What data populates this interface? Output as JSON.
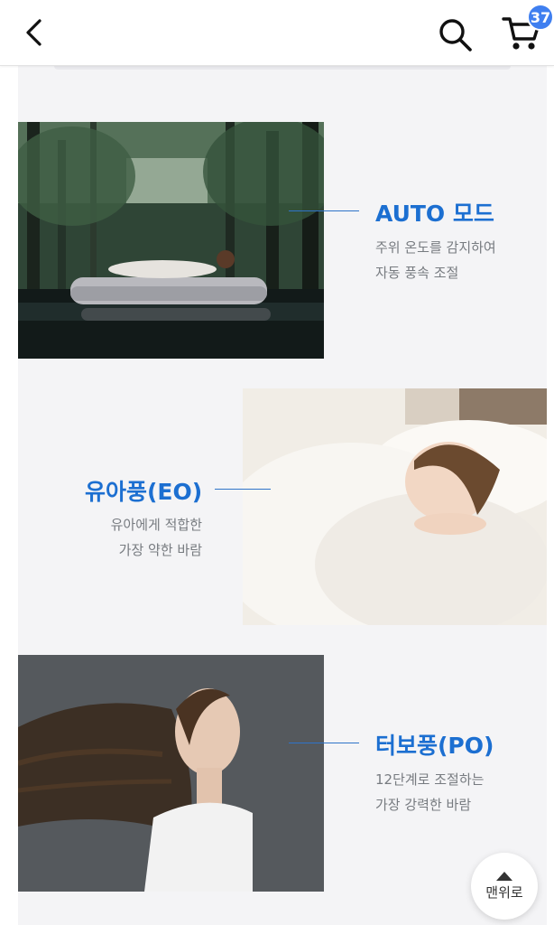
{
  "header": {
    "back_icon": "chevron-left-icon",
    "search_icon": "search-icon",
    "cart_icon": "cart-icon",
    "cart_count": "37",
    "badge_color": "#3f7ff0"
  },
  "modes": [
    {
      "title": "AUTO 모드",
      "desc_line1": "주위 온도를 감지하여",
      "desc_line2": "자동 풍속 조절",
      "photo": "woman-sleeping-on-air-mattress-in-forest-lake"
    },
    {
      "title": "유아풍(EO)",
      "desc_line1": "유아에게 적합한",
      "desc_line2": "가장 약한 바람",
      "photo": "child-sleeping-in-white-bed"
    },
    {
      "title": "터보풍(PO)",
      "desc_line1": "12단계로 조절하는",
      "desc_line2": "가장 강력한 바람",
      "photo": "woman-with-hair-blowing-in-wind"
    }
  ],
  "scroll_top": {
    "label": "맨위로",
    "icon": "triangle-up-icon"
  },
  "accent_color": "#1c6fd1"
}
